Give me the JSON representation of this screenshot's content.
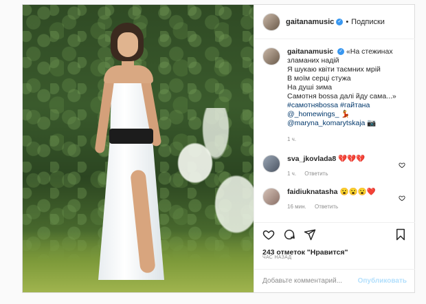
{
  "post": {
    "username": "gaitanamusic",
    "follow_label": "Подписки",
    "caption_lines": [
      "«На стежинах",
      "зламаних надій",
      "Я шукаю квіти таємних мрій",
      "В моїм серці стужа",
      "На душі зима",
      "Самотня bossa далі йду сама...»"
    ],
    "hashtags": "#самотняbossa #гайтана",
    "mention_1": "@_homewings_",
    "mention_1_emoji": "💃",
    "mention_2": "@maryna_komarytskaja",
    "mention_2_emoji": "📷",
    "caption_time": "1 ч."
  },
  "comments": [
    {
      "username": "sva_jkovlada8",
      "text": "💔💔💔",
      "time": "1 ч.",
      "reply_label": "Ответить"
    },
    {
      "username": "faidiuknatasha",
      "text": "😮😮😮❤️",
      "time": "16 мин.",
      "reply_label": "Ответить"
    }
  ],
  "stats": {
    "likes_text": "243 отметок \"Нравится\"",
    "posted_text": "ЧАС НАЗАД"
  },
  "composer": {
    "placeholder": "Добавьте комментарий...",
    "publish_label": "Опубликовать"
  },
  "colors": {
    "verified": "#3897f0",
    "link": "#00376b",
    "publish_disabled": "#b2dffc"
  }
}
